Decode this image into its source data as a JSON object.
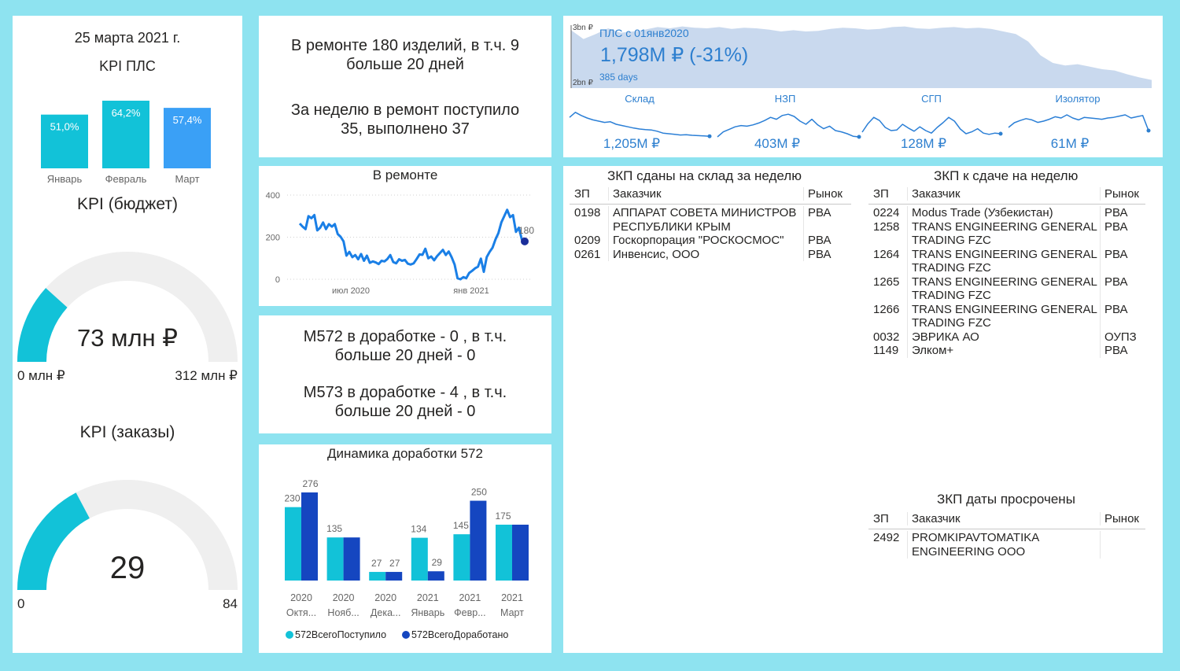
{
  "left": {
    "date": "25 марта 2021 г.",
    "kpi_pls_title": "KPI ПЛС",
    "kpi_budget_title": "KPI (бюджет)",
    "kpi_orders_title": "KPI (заказы)"
  },
  "gauge_budget": {
    "value": 73,
    "min": 0,
    "max": 312,
    "value_label_num": "73",
    "value_label_unit": "млн ₽",
    "min_label": "0 млн ₽",
    "max_label": "312 млн ₽",
    "fill_color": "#12c2d8"
  },
  "gauge_orders": {
    "value": 29,
    "min": 0,
    "max": 84,
    "value_label": "29",
    "min_label": "0",
    "max_label": "84",
    "fill_color": "#12c2d8"
  },
  "repair_text": {
    "line1": "В ремонте 180 изделий, в т.ч. 9",
    "line2": "больше 20 дней",
    "line3": "За неделю в ремонт поступило",
    "line4": "35, выполнено 37"
  },
  "mod_text": {
    "line1": "М572 в доработке - 0 , в т.ч.",
    "line2": "больше 20 дней - 0",
    "line3": "М573 в доработке - 4 , в т.ч.",
    "line4": "больше 20 дней - 0"
  },
  "pls_header": {
    "title": "ПЛС с 01янв2020",
    "value": "1,798M ₽  (-31%)",
    "days": "385 days",
    "axis_top": "3bn ₽",
    "axis_bottom": "2bn ₽"
  },
  "sparklines": [
    {
      "name": "Склад",
      "value": "1,205M ₽"
    },
    {
      "name": "НЗП",
      "value": "403M ₽"
    },
    {
      "name": "СГП",
      "value": "128M ₽"
    },
    {
      "name": "Изолятор",
      "value": "61M ₽"
    }
  ],
  "table_week_done": {
    "title": "ЗКП сданы на склад за неделю",
    "headers": [
      "ЗП",
      "Заказчик",
      "Рынок"
    ],
    "rows": [
      [
        "0198",
        "АППАРАТ СОВЕТА МИНИСТРОВ РЕСПУБЛИКИ КРЫМ",
        "РВА"
      ],
      [
        "0209",
        "Госкорпорация \"РОСКОСМОС\"",
        "РВА"
      ],
      [
        "0261",
        "Инвенсис, ООО",
        "РВА"
      ]
    ]
  },
  "table_week_due": {
    "title": "ЗКП к сдаче на неделю",
    "headers": [
      "ЗП",
      "Заказчик",
      "Рынок"
    ],
    "rows": [
      [
        "0224",
        "Modus Trade (Узбекистан)",
        "РВА"
      ],
      [
        "1258",
        "TRANS ENGINEERING GENERAL TRADING FZC",
        "РВА"
      ],
      [
        "1264",
        "TRANS ENGINEERING GENERAL TRADING FZC",
        "РВА"
      ],
      [
        "1265",
        "TRANS ENGINEERING GENERAL TRADING FZC",
        "РВА"
      ],
      [
        "1266",
        "TRANS ENGINEERING GENERAL TRADING FZC",
        "РВА"
      ],
      [
        "0032",
        "ЭВРИКА АО",
        "ОУПЗ"
      ],
      [
        "1149",
        "Элком+",
        "РВА"
      ]
    ]
  },
  "table_overdue": {
    "title": "ЗКП даты просрочены",
    "headers": [
      "ЗП",
      "Заказчик",
      "Рынок"
    ],
    "rows": [
      [
        "2492",
        "PROMKIPAVTOMATIKA ENGINEERING OOO",
        ""
      ]
    ]
  },
  "chart_data": [
    {
      "type": "bar",
      "categories": [
        "Январь",
        "Февраль",
        "Март"
      ],
      "values": [
        51.0,
        64.2,
        57.4
      ],
      "value_labels": [
        "51,0%",
        "64,2%",
        "57,4%"
      ],
      "colors": [
        "#12c2d8",
        "#12c2d8",
        "#3aa0f6"
      ]
    },
    {
      "type": "line",
      "title": "В ремонте",
      "x_ticks": [
        "июл 2020",
        "янв 2021"
      ],
      "y_ticks": [
        "0",
        "200",
        "400"
      ],
      "ylim": [
        0,
        400
      ],
      "last_label": "180",
      "series": [
        {
          "color": "#1a7fe6",
          "values": [
            265,
            250,
            238,
            300,
            290,
            305,
            232,
            245,
            270,
            238,
            262,
            250,
            262,
            215,
            202,
            180,
            112,
            130,
            105,
            115,
            95,
            120,
            88,
            112,
            78,
            85,
            80,
            72,
            88,
            85,
            96,
            115,
            82,
            76,
            95,
            88,
            92,
            74,
            70,
            76,
            96,
            118,
            116,
            145,
            100,
            108,
            90,
            110,
            125,
            140,
            115,
            132,
            105,
            70,
            5,
            0,
            10,
            5,
            30,
            40,
            52,
            60,
            98,
            35,
            105,
            130,
            150,
            190,
            220,
            270,
            300,
            330,
            295,
            305,
            225,
            245,
            190,
            180
          ]
        }
      ]
    },
    {
      "type": "bar",
      "title": "Динамика доработки 572",
      "categories": [
        [
          "2020",
          "Октя..."
        ],
        [
          "2020",
          "Нояб..."
        ],
        [
          "2020",
          "Дека..."
        ],
        [
          "2021",
          "Январь"
        ],
        [
          "2021",
          "Февр..."
        ],
        [
          "2021",
          "Март"
        ]
      ],
      "ylim": [
        0,
        280
      ],
      "series": [
        {
          "name": "572ВсегоПоступило",
          "color": "#12c2d8",
          "values": [
            230,
            135,
            27,
            134,
            145,
            175
          ]
        },
        {
          "name": "572ВсегоДоработано",
          "color": "#1546c0",
          "values": [
            276,
            135,
            27,
            29,
            250,
            175
          ]
        }
      ],
      "value_labels": [
        [
          "230",
          "276"
        ],
        [
          "135",
          ""
        ],
        [
          "27",
          "27"
        ],
        [
          "134",
          "29"
        ],
        [
          "145",
          "250"
        ],
        [
          "175",
          ""
        ]
      ]
    },
    {
      "type": "area",
      "title": "ПЛС с 01янв2020",
      "y_ticks": [
        "3bn ₽",
        "2bn ₽"
      ],
      "ylim": [
        2.0,
        3.0
      ],
      "series": [
        {
          "color": "#c9d9ee",
          "values": [
            2.92,
            2.78,
            2.86,
            2.95,
            2.88,
            2.9,
            2.93,
            2.97,
            2.95,
            2.98,
            2.96,
            2.95,
            2.97,
            2.94,
            2.96,
            2.95,
            2.93,
            2.9,
            2.92,
            2.9,
            2.91,
            2.94,
            2.96,
            2.95,
            2.93,
            2.94,
            2.97,
            2.98,
            2.95,
            2.94,
            2.96,
            2.97,
            2.95,
            2.96,
            2.94,
            2.9,
            2.86,
            2.74,
            2.52,
            2.4,
            2.36,
            2.38,
            2.34,
            2.3,
            2.28,
            2.22,
            2.17,
            2.13
          ]
        }
      ]
    },
    {
      "type": "line",
      "title": "Склад",
      "series": [
        {
          "color": "#2b7fd6",
          "values": [
            0.72,
            0.88,
            0.78,
            0.7,
            0.64,
            0.6,
            0.56,
            0.58,
            0.5,
            0.46,
            0.42,
            0.38,
            0.35,
            0.33,
            0.32,
            0.28,
            0.22,
            0.2,
            0.18,
            0.16,
            0.17,
            0.15,
            0.14,
            0.13,
            0.12
          ]
        }
      ]
    },
    {
      "type": "line",
      "title": "НЗП",
      "series": [
        {
          "color": "#2b7fd6",
          "values": [
            0.1,
            0.26,
            0.34,
            0.42,
            0.46,
            0.44,
            0.48,
            0.54,
            0.62,
            0.72,
            0.66,
            0.78,
            0.82,
            0.75,
            0.6,
            0.5,
            0.66,
            0.48,
            0.36,
            0.44,
            0.3,
            0.26,
            0.2,
            0.12,
            0.1
          ]
        }
      ]
    },
    {
      "type": "line",
      "title": "СГП",
      "series": [
        {
          "color": "#2b7fd6",
          "values": [
            0.25,
            0.52,
            0.72,
            0.62,
            0.4,
            0.3,
            0.32,
            0.5,
            0.38,
            0.28,
            0.42,
            0.3,
            0.22,
            0.4,
            0.55,
            0.72,
            0.6,
            0.35,
            0.2,
            0.26,
            0.36,
            0.22,
            0.18,
            0.22,
            0.2
          ]
        }
      ]
    },
    {
      "type": "line",
      "title": "Изолятор",
      "series": [
        {
          "color": "#2b7fd6",
          "values": [
            0.4,
            0.55,
            0.62,
            0.68,
            0.64,
            0.56,
            0.6,
            0.66,
            0.74,
            0.7,
            0.8,
            0.7,
            0.64,
            0.72,
            0.7,
            0.68,
            0.66,
            0.7,
            0.72,
            0.76,
            0.8,
            0.7,
            0.74,
            0.78,
            0.3
          ]
        }
      ]
    }
  ]
}
